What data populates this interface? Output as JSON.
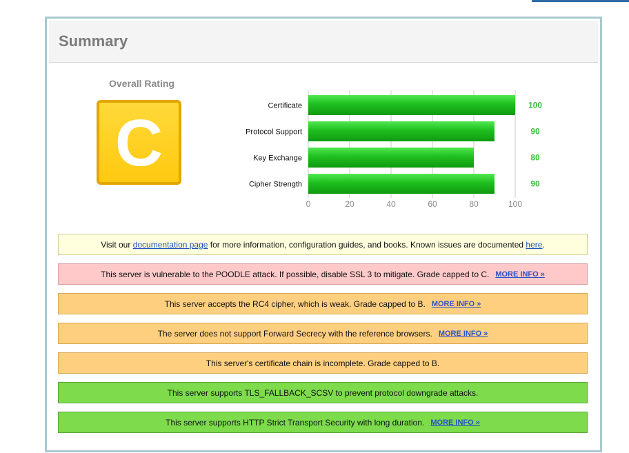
{
  "summary": {
    "title": "Summary",
    "overall_rating_label": "Overall Rating",
    "grade": "C",
    "grade_color": "#ffc910"
  },
  "chart_data": {
    "type": "bar",
    "orientation": "horizontal",
    "categories": [
      "Certificate",
      "Protocol Support",
      "Key Exchange",
      "Cipher Strength"
    ],
    "values": [
      100,
      90,
      80,
      90
    ],
    "value_labels": [
      "100",
      "90",
      "80",
      "90"
    ],
    "xlim": [
      0,
      100
    ],
    "xticks": [
      0,
      20,
      40,
      60,
      80,
      100
    ],
    "xtick_labels": [
      "0",
      "20",
      "40",
      "60",
      "80",
      "100"
    ],
    "grid": true,
    "bar_color": "#1fbf1f",
    "value_label_color": "#3cbf3c",
    "title": "",
    "xlabel": "",
    "ylabel": ""
  },
  "notices": {
    "documentation": {
      "text_before": "Visit our",
      "link_documentation": "documentation page",
      "text_middle": "for more information, configuration guides, and books. Known issues are documented",
      "link_here": "here",
      "text_after": "."
    },
    "poodle": {
      "text": "This server is vulnerable to the POODLE attack. If possible, disable SSL 3 to mitigate. Grade capped to C.",
      "more": "MORE INFO »"
    },
    "rc4": {
      "text": "This server accepts the RC4 cipher, which is weak. Grade capped to B.",
      "more": "MORE INFO »"
    },
    "forward_secrecy": {
      "text": "The server does not support Forward Secrecy with the reference browsers.",
      "more": "MORE INFO »"
    },
    "chain": {
      "text": "This server's certificate chain is incomplete. Grade capped to B."
    },
    "fallback_scsv": {
      "text": "This server supports TLS_FALLBACK_SCSV to prevent protocol downgrade attacks."
    },
    "hsts": {
      "text": "This server supports HTTP Strict Transport Security with long duration.",
      "more": "MORE INFO »"
    }
  }
}
